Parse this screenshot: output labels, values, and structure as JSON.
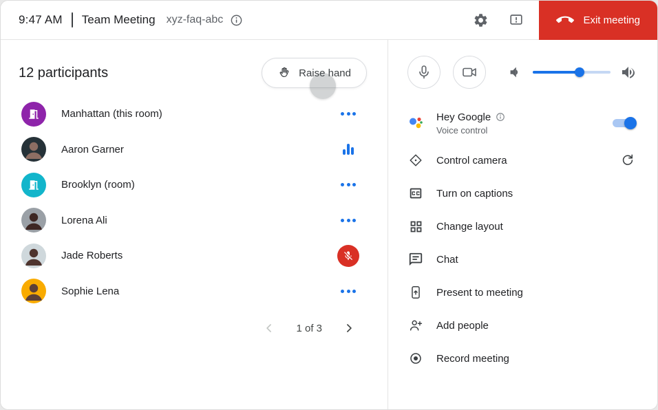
{
  "header": {
    "time": "9:47 AM",
    "meeting_title": "Team Meeting",
    "meeting_code": "xyz-faq-abc",
    "exit_button": "Exit meeting"
  },
  "participants": {
    "title": "12 participants",
    "raise_hand": "Raise hand",
    "items": [
      {
        "name": "Manhattan (this room)",
        "kind": "room",
        "status": "menu"
      },
      {
        "name": "Aaron Garner",
        "kind": "person",
        "status": "speaking"
      },
      {
        "name": "Brooklyn (room)",
        "kind": "room",
        "status": "menu"
      },
      {
        "name": "Lorena Ali",
        "kind": "person",
        "status": "menu"
      },
      {
        "name": "Jade Roberts",
        "kind": "person",
        "status": "muted"
      },
      {
        "name": "Sophie Lena",
        "kind": "person",
        "status": "menu"
      }
    ],
    "pagination": "1 of 3"
  },
  "controls": {
    "volume_percent": 60,
    "hey_google": {
      "title": "Hey Google",
      "subtitle": "Voice control",
      "enabled": true
    },
    "menu": [
      {
        "label": "Control camera"
      },
      {
        "label": "Turn on captions"
      },
      {
        "label": "Change layout"
      },
      {
        "label": "Chat"
      },
      {
        "label": "Present to meeting"
      },
      {
        "label": "Add people"
      },
      {
        "label": "Record meeting"
      }
    ]
  },
  "colors": {
    "accent_blue": "#1a73e8",
    "exit_red": "#d93025",
    "room_purple": "#8e24aa",
    "room_teal": "#12b5cb"
  }
}
